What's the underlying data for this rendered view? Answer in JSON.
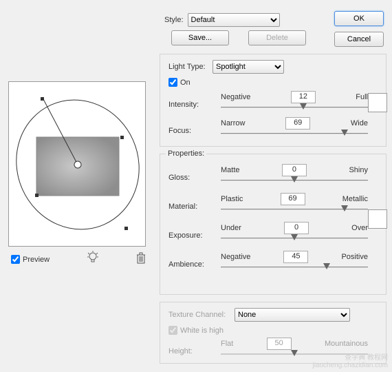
{
  "style": {
    "label": "Style:",
    "value": "Default",
    "save": "Save...",
    "delete": "Delete"
  },
  "buttons": {
    "ok": "OK",
    "cancel": "Cancel"
  },
  "preview": {
    "checkbox_label": "Preview",
    "checked": true
  },
  "light": {
    "type_label": "Light Type:",
    "type_value": "Spotlight",
    "on_label": "On",
    "on_checked": true,
    "intensity": {
      "label": "Intensity:",
      "left": "Negative",
      "right": "Full",
      "value": 12,
      "pct": 56
    },
    "focus": {
      "label": "Focus:",
      "left": "Narrow",
      "right": "Wide",
      "value": 69,
      "pct": 84
    },
    "swatch": "#ffffff"
  },
  "props": {
    "header": "Properties:",
    "gloss": {
      "label": "Gloss:",
      "left": "Matte",
      "right": "Shiny",
      "value": 0,
      "pct": 50
    },
    "material": {
      "label": "Material:",
      "left": "Plastic",
      "right": "Metallic",
      "value": 69,
      "pct": 84
    },
    "exposure": {
      "label": "Exposure:",
      "left": "Under",
      "right": "Over",
      "value": 0,
      "pct": 50
    },
    "ambience": {
      "label": "Ambience:",
      "left": "Negative",
      "right": "Positive",
      "value": 45,
      "pct": 72
    },
    "swatch": "#ffffff"
  },
  "texture": {
    "channel_label": "Texture Channel:",
    "channel_value": "None",
    "white_label": "White is high",
    "white_checked": true,
    "height": {
      "label": "Height:",
      "left": "Flat",
      "right": "Mountainous",
      "value": 50,
      "pct": 50
    }
  },
  "watermark": "jiaocheng.chazidian.com",
  "watermark_cn": "查字典 教程网"
}
